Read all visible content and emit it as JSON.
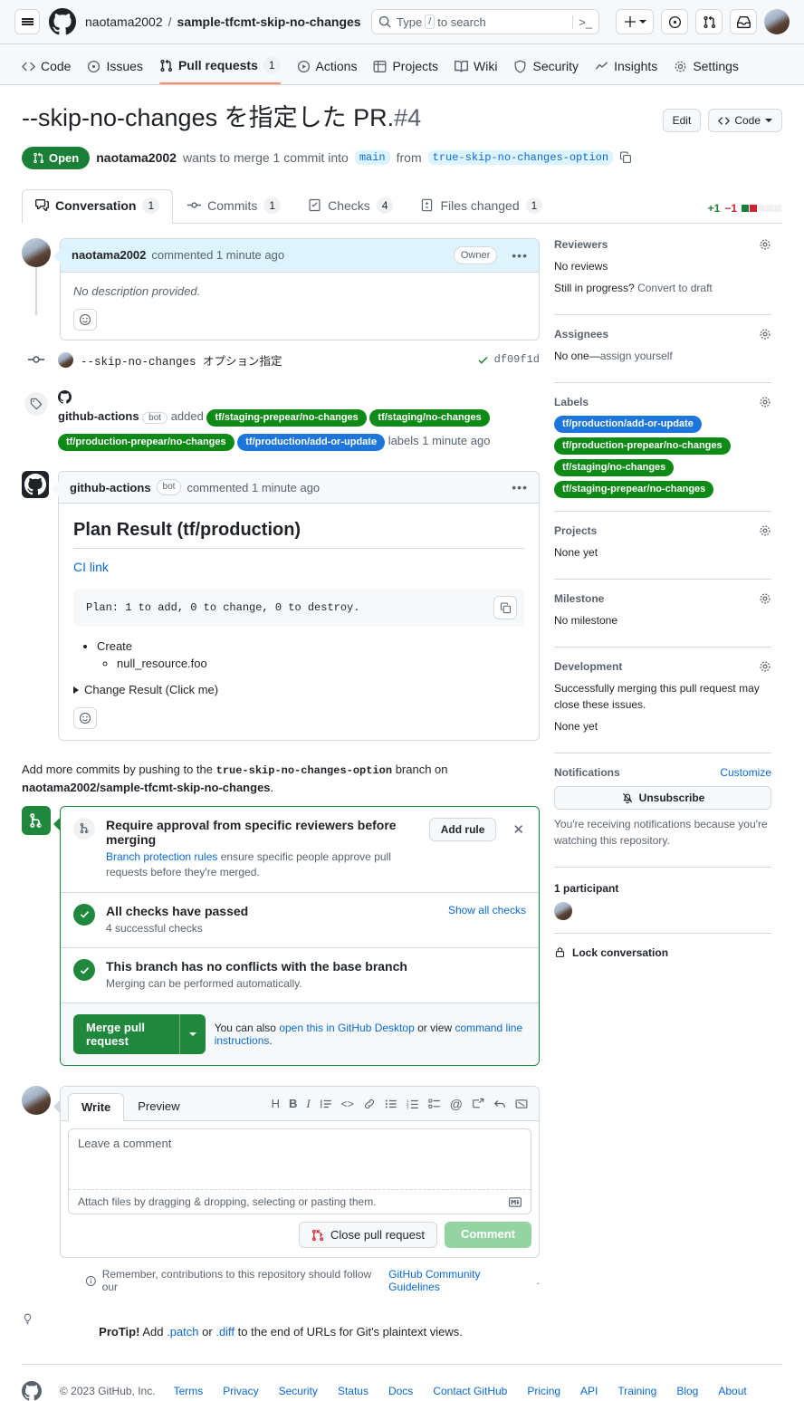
{
  "header": {
    "owner": "naotama2002",
    "separator": "/",
    "repo": "sample-tfcmt-skip-no-changes",
    "search_placeholder": "Type",
    "search_slash": "/",
    "search_suffix": "to search",
    "icons": [
      "hamburger-icon",
      "github-logo-icon",
      "search-icon",
      "command-palette-icon",
      "plus-icon",
      "issues-icon",
      "pull-requests-icon",
      "inbox-icon",
      "avatar"
    ]
  },
  "repo_nav": [
    {
      "label": "Code",
      "icon": "code-icon",
      "count": "",
      "active": false
    },
    {
      "label": "Issues",
      "icon": "issue-opened-icon",
      "count": "",
      "active": false
    },
    {
      "label": "Pull requests",
      "icon": "git-pull-request-icon",
      "count": "1",
      "active": true
    },
    {
      "label": "Actions",
      "icon": "play-icon",
      "count": "",
      "active": false
    },
    {
      "label": "Projects",
      "icon": "table-icon",
      "count": "",
      "active": false
    },
    {
      "label": "Wiki",
      "icon": "book-icon",
      "count": "",
      "active": false
    },
    {
      "label": "Security",
      "icon": "shield-icon",
      "count": "",
      "active": false
    },
    {
      "label": "Insights",
      "icon": "graph-icon",
      "count": "",
      "active": false
    },
    {
      "label": "Settings",
      "icon": "gear-icon",
      "count": "",
      "active": false
    }
  ],
  "pr": {
    "title": "--skip-no-changes を指定した PR.",
    "number": "#4",
    "edit_label": "Edit",
    "code_label": "Code",
    "state": "Open",
    "author": "naotama2002",
    "merge_text_1": "wants to merge 1 commit into",
    "base_branch": "main",
    "merge_text_2": "from",
    "head_branch": "true-skip-no-changes-option",
    "copy_branch_icon": "copy-icon"
  },
  "tabs": [
    {
      "label": "Conversation",
      "count": "1",
      "icon": "comment-discussion-icon",
      "active": true
    },
    {
      "label": "Commits",
      "count": "1",
      "icon": "git-commit-icon",
      "active": false
    },
    {
      "label": "Checks",
      "count": "4",
      "icon": "checklist-icon",
      "active": false
    },
    {
      "label": "Files changed",
      "count": "1",
      "icon": "file-diff-icon",
      "active": false
    }
  ],
  "diffstat": {
    "additions": "+1",
    "deletions": "−1"
  },
  "first_comment": {
    "author": "naotama2002",
    "action": "commented 1 minute ago",
    "role_badge": "Owner",
    "body": "No description provided."
  },
  "commit_event": {
    "message": "--skip-no-changes オプション指定",
    "sha": "df09f1d"
  },
  "label_event": {
    "actor": "github-actions",
    "bot_tag": "bot",
    "verb": "added",
    "labels": [
      {
        "name": "tf/staging-prepear/no-changes",
        "color": "#0E8A16"
      },
      {
        "name": "tf/staging/no-changes",
        "color": "#0E8A16"
      },
      {
        "name": "tf/production-prepear/no-changes",
        "color": "#0E8A16"
      },
      {
        "name": "tf/production/add-or-update",
        "color": "#1D76DB"
      }
    ],
    "suffix": "labels 1 minute ago"
  },
  "bot_comment": {
    "author": "github-actions",
    "bot_tag": "bot",
    "action": "commented 1 minute ago",
    "heading": "Plan Result (tf/production)",
    "ci_link": "CI link",
    "code": "Plan: 1 to add, 0 to change, 0 to destroy.",
    "list": [
      {
        "label": "Create",
        "children": [
          "null_resource.foo"
        ]
      }
    ],
    "details_summary": "Change Result (Click me)"
  },
  "push_note": {
    "prefix": "Add more commits by pushing to the",
    "branch": "true-skip-no-changes-option",
    "middle": "branch on",
    "repo": "naotama2002/sample-tfcmt-skip-no-changes",
    "suffix": "."
  },
  "merge_box": {
    "rule": {
      "title": "Require approval from specific reviewers before merging",
      "link": "Branch protection rules",
      "desc": "ensure specific people approve pull requests before they're merged.",
      "button": "Add rule",
      "close_icon": "close-icon"
    },
    "checks": {
      "title": "All checks have passed",
      "sub": "4 successful checks",
      "link": "Show all checks"
    },
    "conflicts": {
      "title": "This branch has no conflicts with the base branch",
      "sub": "Merging can be performed automatically."
    },
    "footer": {
      "button": "Merge pull request",
      "note_1": "You can also",
      "link_1": "open this in GitHub Desktop",
      "note_2": "or view",
      "link_2": "command line instructions",
      "note_3": "."
    }
  },
  "comment_form": {
    "tabs": [
      "Write",
      "Preview"
    ],
    "toolbar": [
      "heading-icon",
      "bold-icon",
      "italic-icon",
      "quote-icon",
      "code-icon",
      "link-icon",
      "unordered-list-icon",
      "ordered-list-icon",
      "task-list-icon",
      "mention-icon",
      "reference-icon",
      "reply-icon",
      "markdown-icon"
    ],
    "placeholder": "Leave a comment",
    "attach_note": "Attach files by dragging & dropping, selecting or pasting them.",
    "close_button": "Close pull request",
    "comment_button": "Comment"
  },
  "reminder": {
    "text": "Remember, contributions to this repository should follow our",
    "link": "GitHub Community Guidelines",
    "suffix": "."
  },
  "protip": {
    "label": "ProTip!",
    "text_1": "Add",
    "link_1": ".patch",
    "text_2": "or",
    "link_2": ".diff",
    "text_3": "to the end of URLs for Git's plaintext views."
  },
  "sidebar": {
    "reviewers": {
      "title": "Reviewers",
      "no_reviews": "No reviews",
      "still_prefix": "Still in progress?",
      "convert_link": "Convert to draft"
    },
    "assignees": {
      "title": "Assignees",
      "none_prefix": "No one—",
      "link": "assign yourself"
    },
    "labels": {
      "title": "Labels",
      "items": [
        {
          "name": "tf/production/add-or-update",
          "color": "#1D76DB"
        },
        {
          "name": "tf/production-prepear/no-changes",
          "color": "#0E8A16"
        },
        {
          "name": "tf/staging/no-changes",
          "color": "#0E8A16"
        },
        {
          "name": "tf/staging-prepear/no-changes",
          "color": "#0E8A16"
        }
      ]
    },
    "projects": {
      "title": "Projects",
      "value": "None yet"
    },
    "milestone": {
      "title": "Milestone",
      "value": "No milestone"
    },
    "development": {
      "title": "Development",
      "desc": "Successfully merging this pull request may close these issues.",
      "value": "None yet"
    },
    "notifications": {
      "title": "Notifications",
      "customize": "Customize",
      "button": "Unsubscribe",
      "desc": "You're receiving notifications because you're watching this repository."
    },
    "participants": {
      "title": "1 participant"
    },
    "lock": {
      "label": "Lock conversation",
      "icon": "lock-icon"
    }
  },
  "footer": {
    "copyright": "© 2023 GitHub, Inc.",
    "links": [
      "Terms",
      "Privacy",
      "Security",
      "Status",
      "Docs",
      "Contact GitHub",
      "Pricing",
      "API",
      "Training",
      "Blog",
      "About"
    ]
  }
}
